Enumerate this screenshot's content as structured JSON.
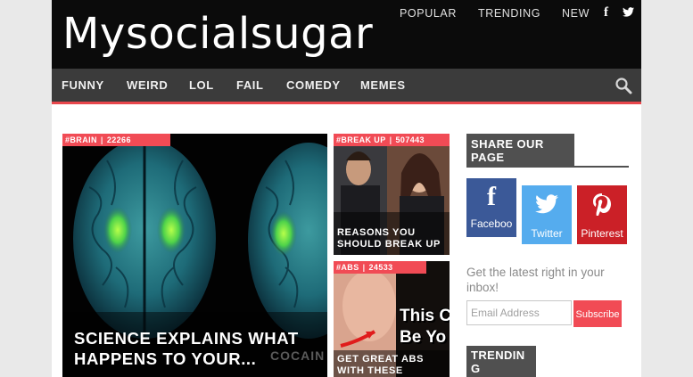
{
  "site": {
    "logo": "Mysocialsugar"
  },
  "topnav": {
    "popular": "POPULAR",
    "trending": "TRENDING",
    "new": "NEW",
    "facebook_glyph": "f",
    "twitter_glyph": "🐦"
  },
  "nav": {
    "items": [
      "FUNNY",
      "WEIRD",
      "LOL",
      "FAIL",
      "COMEDY",
      "MEMES"
    ]
  },
  "articles": [
    {
      "tag": "#BRAIN",
      "count": "22266",
      "title": "SCIENCE EXPLAINS WHAT HAPPENS TO YOUR...",
      "watermark": "COCAIN"
    },
    {
      "tag": "#BREAK UP",
      "count": "507443",
      "title": "REASONS YOU SHOULD BREAK UP"
    },
    {
      "tag": "#ABS",
      "count": "24533",
      "title": "GET GREAT ABS WITH THESE TRICKS!",
      "overlay": "This C Be Yo"
    }
  ],
  "sidebar": {
    "share_heading": "SHARE OUR PAGE",
    "social": [
      {
        "label": "Faceboo",
        "glyph": "f",
        "color": "#3b5998",
        "icon": "facebook-icon"
      },
      {
        "label": "Twitter",
        "glyph": "",
        "color": "#55acee",
        "icon": "twitter-icon"
      },
      {
        "label": "Pinterest",
        "glyph": "P",
        "color": "#cb2027",
        "icon": "pinterest-icon"
      }
    ],
    "inbox_text": "Get the latest right in your inbox!",
    "email_placeholder": "Email Address",
    "subscribe": "Subscribe",
    "trending_heading": "TRENDING"
  },
  "colors": {
    "accent": "#f14b55",
    "nav_bg": "#3b3b3b",
    "header_bg": "#0b0b0b"
  }
}
